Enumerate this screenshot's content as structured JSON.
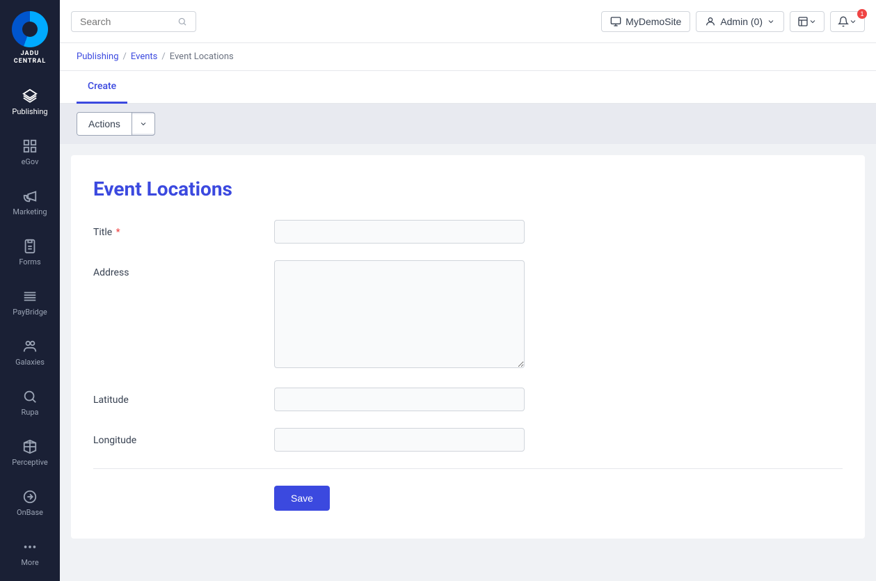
{
  "sidebar": {
    "logo": {
      "line1": "JADU",
      "line2": "CENTRAL"
    },
    "items": [
      {
        "id": "publishing",
        "label": "Publishing",
        "icon": "layers-icon",
        "active": true
      },
      {
        "id": "egov",
        "label": "eGov",
        "icon": "grid-icon",
        "active": false
      },
      {
        "id": "marketing",
        "label": "Marketing",
        "icon": "megaphone-icon",
        "active": false
      },
      {
        "id": "forms",
        "label": "Forms",
        "icon": "clipboard-icon",
        "active": false
      },
      {
        "id": "paybridge",
        "label": "PayBridge",
        "icon": "menu-icon",
        "active": false
      },
      {
        "id": "galaxies",
        "label": "Galaxies",
        "icon": "people-icon",
        "active": false
      },
      {
        "id": "rupa",
        "label": "Rupa",
        "icon": "search-circle-icon",
        "active": false
      },
      {
        "id": "perceptive",
        "label": "Perceptive",
        "icon": "cube-icon",
        "active": false
      },
      {
        "id": "onbase",
        "label": "OnBase",
        "icon": "arrow-right-circle-icon",
        "active": false
      },
      {
        "id": "more",
        "label": "More",
        "icon": "dots-icon",
        "active": false
      }
    ]
  },
  "topbar": {
    "search_placeholder": "Search",
    "site_label": "MyDemoSite",
    "admin_label": "Admin (0)",
    "notification_count": "1"
  },
  "breadcrumb": {
    "items": [
      "Publishing",
      "Events",
      "Event Locations"
    ],
    "separators": [
      "/",
      "/"
    ]
  },
  "tabs": [
    {
      "id": "create",
      "label": "Create",
      "active": true
    }
  ],
  "actions": {
    "label": "Actions"
  },
  "form": {
    "title": "Event Locations",
    "fields": [
      {
        "id": "title",
        "label": "Title",
        "required": true,
        "type": "input",
        "placeholder": ""
      },
      {
        "id": "address",
        "label": "Address",
        "required": false,
        "type": "textarea",
        "placeholder": ""
      },
      {
        "id": "latitude",
        "label": "Latitude",
        "required": false,
        "type": "input",
        "placeholder": ""
      },
      {
        "id": "longitude",
        "label": "Longitude",
        "required": false,
        "type": "input",
        "placeholder": ""
      }
    ],
    "save_label": "Save"
  }
}
